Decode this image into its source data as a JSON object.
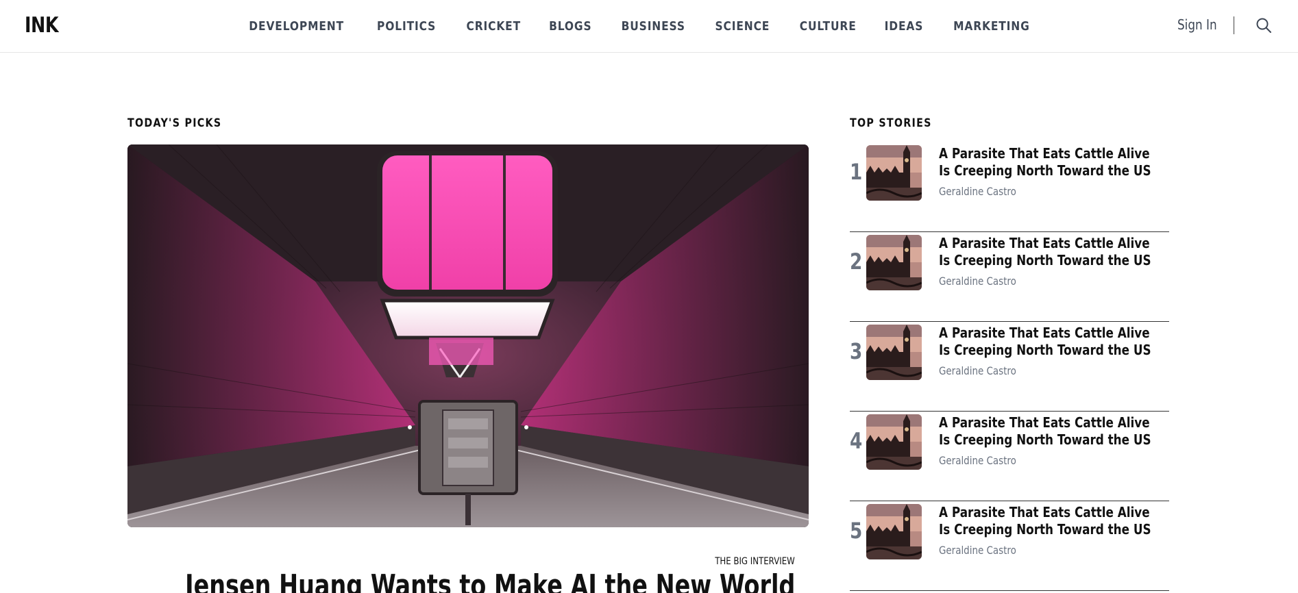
{
  "header": {
    "logo": "INK",
    "nav": [
      "DEVELOPMENT",
      "POLITICS",
      "CRICKET",
      "BLOGS",
      "BUSINESS",
      "SCIENCE",
      "CULTURE",
      "IDEAS",
      "MARKETING"
    ],
    "sign_in": "Sign In",
    "search_icon": "search-icon"
  },
  "picks": {
    "title": "TODAY'S PICKS",
    "kicker": "THE BIG INTERVIEW",
    "headline": "Jensen Huang Wants to Make AI the New World"
  },
  "top_stories": {
    "title": "TOP STORIES",
    "items": [
      {
        "num": "1",
        "title": "A Parasite That Eats Cattle Alive Is Creeping North Toward the US",
        "author": "Geraldine Castro"
      },
      {
        "num": "2",
        "title": "A Parasite That Eats Cattle Alive Is Creeping North Toward the US",
        "author": "Geraldine Castro"
      },
      {
        "num": "3",
        "title": "A Parasite That Eats Cattle Alive Is Creeping North Toward the US",
        "author": "Geraldine Castro"
      },
      {
        "num": "4",
        "title": "A Parasite That Eats Cattle Alive Is Creeping North Toward the US",
        "author": "Geraldine Castro"
      },
      {
        "num": "5",
        "title": "A Parasite That Eats Cattle Alive Is Creeping North Toward the US",
        "author": "Geraldine Castro"
      }
    ]
  },
  "colors": {
    "nav_text": "#3d4654",
    "muted": "#6b7380",
    "accent_pink": "#ff4fb4"
  }
}
